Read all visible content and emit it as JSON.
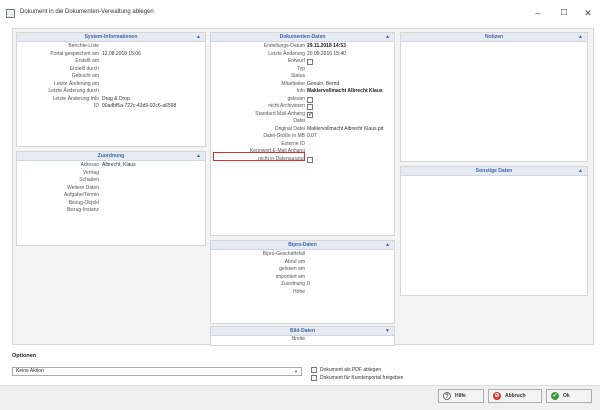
{
  "window": {
    "title": "Dokument in die Dokumenten-Verwaltung ablegen",
    "minimize": "–",
    "maximize": "☐",
    "close": "✕"
  },
  "system_info": {
    "header": "System-Informationen",
    "rows": [
      {
        "label": "Berichte-Liste",
        "value": ""
      },
      {
        "label": "Portal gespeichert am",
        "value": "12.08.2018 15:06"
      },
      {
        "label": "Erstellt am",
        "value": ""
      },
      {
        "label": "Erstellt durch",
        "value": ""
      },
      {
        "label": "Gebucht am",
        "value": ""
      },
      {
        "label": "Letzte Änderung am",
        "value": ""
      },
      {
        "label": "Letzte Änderung durch",
        "value": ""
      },
      {
        "label": "Letzte Änderung Info",
        "value": "Drag & Drop"
      },
      {
        "label": "ID",
        "value": "90adbf5a-722c-43d9-92c6-a6598"
      }
    ]
  },
  "assignment": {
    "header": "Zuordnung",
    "rows": [
      {
        "label": "Adresse",
        "value": "Albrecht, Klaus"
      },
      {
        "label": "Vertrag",
        "value": ""
      },
      {
        "label": "Schaden",
        "value": ""
      },
      {
        "label": "Weitere Daten",
        "value": ""
      },
      {
        "label": "Aufgabe/Termin",
        "value": ""
      },
      {
        "label": "Bezug-Objekt",
        "value": ""
      },
      {
        "label": "Bezug-Instanz",
        "value": ""
      }
    ]
  },
  "document_data": {
    "header": "Dokumenten-Daten",
    "rows": [
      {
        "label": "Erstellungs-Datum",
        "value": "29.11.2018 14:53",
        "bold": true
      },
      {
        "label": "Letzte Änderung",
        "value": "20.09.2016 15:40"
      },
      {
        "label": "Entwurf",
        "checkbox": true,
        "checked": false
      },
      {
        "label": "Typ",
        "value": ""
      },
      {
        "label": "Status",
        "value": ""
      },
      {
        "label": "Mitarbeiter",
        "value": "Genuin, Bernd"
      },
      {
        "label": "Info",
        "value": "Maklervollmacht Albrecht Klaus",
        "bold": true
      },
      {
        "label": "gelesen",
        "checkbox": true,
        "checked": false
      },
      {
        "label": "nicht Archivieren",
        "checkbox": true,
        "checked": false
      },
      {
        "label": "Standard Mail-Anhang",
        "checkbox": true,
        "checked": true
      },
      {
        "label": "Datei",
        "value": ""
      },
      {
        "label": "Original Datei",
        "value": "Maklervollmacht Albrecht Klaus.pd"
      },
      {
        "label": "Datei-Größe in MB",
        "value": "0.07"
      },
      {
        "label": "Externe ID",
        "value": ""
      },
      {
        "label": "Kennwort E-Mail Anhang",
        "value": ""
      },
      {
        "label": "nicht in Datenauszug",
        "checkbox": true,
        "checked": false
      }
    ]
  },
  "bipro_data": {
    "header": "Bipro-Daten",
    "rows": [
      {
        "label": "Bipro-Geschäftsfall",
        "value": ""
      },
      {
        "label": "Abruf am",
        "value": ""
      },
      {
        "label": "gelesen am",
        "value": ""
      },
      {
        "label": "importiert am",
        "value": ""
      },
      {
        "label": "Zuordnung",
        "value": "0"
      },
      {
        "label": "Höhe",
        "value": ""
      }
    ]
  },
  "image_data": {
    "header": "Bild-Daten",
    "rows": [
      {
        "label": "Breite",
        "value": ""
      }
    ]
  },
  "notes": {
    "header": "Notizen"
  },
  "other_data": {
    "header": "Sonstige Daten"
  },
  "options": {
    "label": "Optionen",
    "select_value": "Keine Aktion",
    "pdf_label": "Dokument als PDF ablegen",
    "portal_label": "Dokument für Kundenportal freigeben"
  },
  "buttons": {
    "help": "Hilfe",
    "cancel": "Abbruch",
    "ok": "Ok"
  },
  "colors": {
    "accent": "#3b66a8",
    "highlight": "#d93030",
    "cancel": "#d9342c",
    "ok": "#3f9b3f"
  },
  "icons": {
    "collapse": "chevron-up-icon",
    "help": "question-icon",
    "cancel": "cancel-icon",
    "ok": "check-icon"
  }
}
